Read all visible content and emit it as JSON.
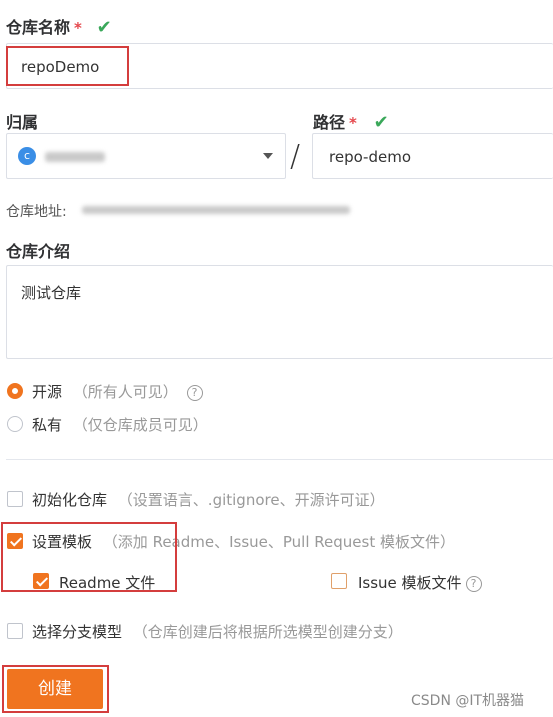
{
  "repo_name": {
    "label": "仓库名称",
    "required_mark": "*",
    "value": "repoDemo"
  },
  "owner": {
    "label": "归属"
  },
  "path": {
    "label": "路径",
    "required_mark": "*",
    "separator": "/",
    "value": "repo-demo"
  },
  "repo_address": {
    "label": "仓库地址:"
  },
  "description": {
    "label": "仓库介绍",
    "value": "测试仓库"
  },
  "visibility": {
    "public_label": "开源",
    "public_hint": "（所有人可见）",
    "private_label": "私有",
    "private_hint": "（仅仓库成员可见）",
    "selected": "public"
  },
  "init_repo": {
    "label": "初始化仓库",
    "hint": "（设置语言、.gitignore、开源许可证）",
    "checked": false
  },
  "templates": {
    "label": "设置模板",
    "hint": "（添加 Readme、Issue、Pull Request 模板文件）",
    "checked": true,
    "readme_label": "Readme 文件",
    "readme_checked": true,
    "issue_label": "Issue 模板文件",
    "issue_checked": false
  },
  "branch_model": {
    "label": "选择分支模型",
    "hint": "（仓库创建后将根据所选模型创建分支）",
    "checked": false
  },
  "create_button": {
    "label": "创建"
  },
  "watermark": "CSDN @IT机器猫",
  "colors": {
    "accent": "#f0741f",
    "success": "#3aa85a",
    "required": "#e5484d",
    "annotation": "#d43d3d"
  }
}
